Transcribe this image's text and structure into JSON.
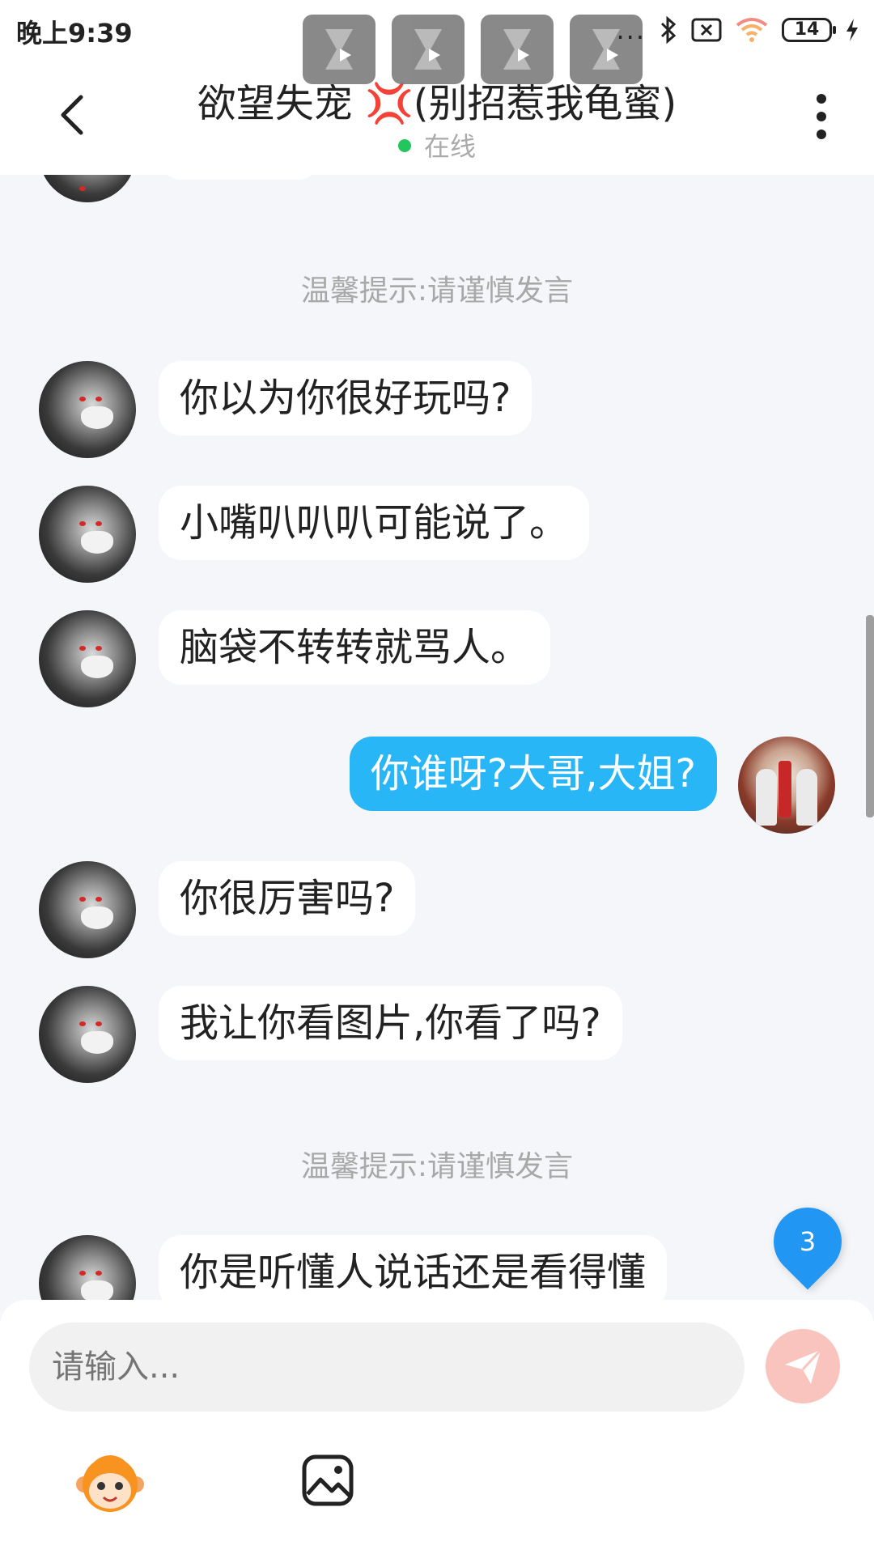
{
  "status_bar": {
    "time": "晚上9:39",
    "dots": "...",
    "battery": "14"
  },
  "header": {
    "title_name": "欲望失宠 ",
    "title_emoji": "💢",
    "title_note": "(别招惹我龟蜜)",
    "status": "在线"
  },
  "chat": {
    "tip_1": "温馨提示:请谨慎发言",
    "tip_2": "温馨提示:请谨慎发言",
    "messages": [
      {
        "side": "left",
        "text": "你以为你很好玩吗?"
      },
      {
        "side": "left",
        "text": "小嘴叭叭叭可能说了。"
      },
      {
        "side": "left",
        "text": "脑袋不转转就骂人。"
      },
      {
        "side": "right",
        "text": "你谁呀?大哥,大姐?"
      },
      {
        "side": "left",
        "text": "你很厉害吗?"
      },
      {
        "side": "left",
        "text": "我让你看图片,你看了吗?"
      },
      {
        "side": "left",
        "text": "你是听懂人说话还是看得懂"
      }
    ],
    "unread_count": "3"
  },
  "input": {
    "placeholder": "请输入..."
  },
  "icons": {
    "back": "back-arrow-icon",
    "more": "more-vertical-icon",
    "send": "send-icon",
    "emoji": "emoji-monkey-icon",
    "image": "image-icon"
  },
  "colors": {
    "my_bubble": "#29b6f6",
    "online_dot": "#22c55e",
    "send_button": "#f8c4bd",
    "badge": "#2196f3"
  }
}
